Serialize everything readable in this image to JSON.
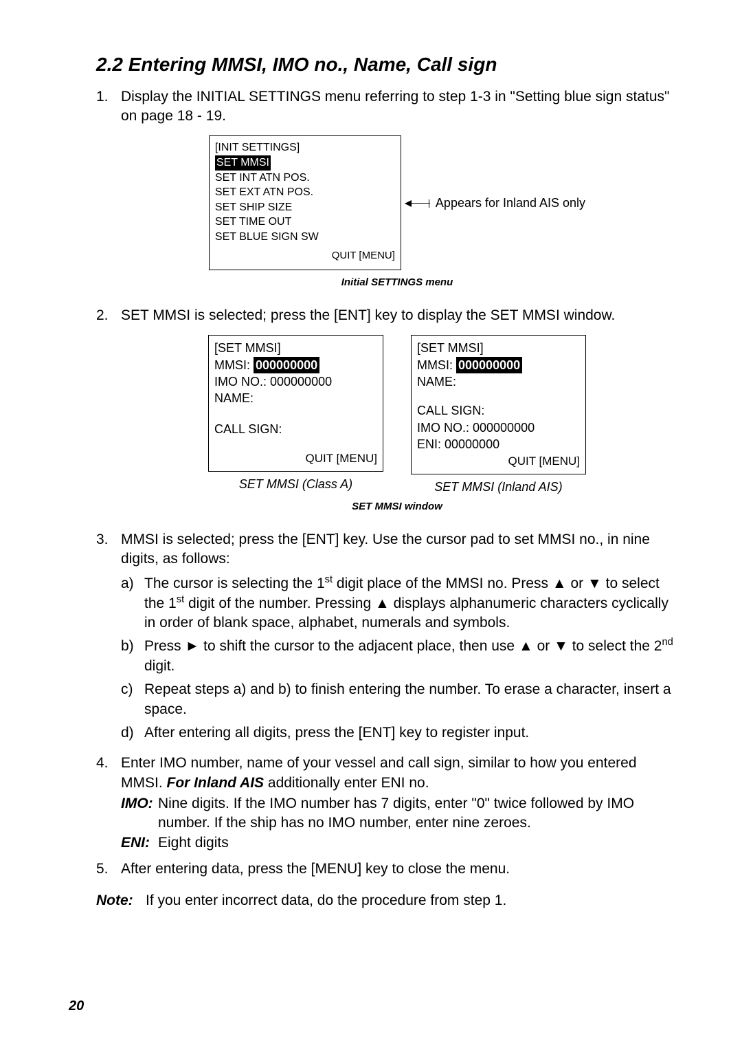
{
  "heading": "2.2 Entering MMSI, IMO no., Name, Call sign",
  "steps": {
    "s1": "Display the INITIAL SETTINGS menu referring to step 1-3 in \"Setting blue sign status\" on page 18 - 19.",
    "s2": "SET MMSI is selected; press the [ENT] key to display the SET MMSI window.",
    "s3_lead": "MMSI is selected; press the [ENT] key. Use the cursor pad to set MMSI no., in nine digits, as follows:",
    "s3a": "The cursor is selecting the 1st digit place of the MMSI no. Press ▲ or ▼ to select the 1st digit of the number. Pressing ▲ displays alphanumeric characters cyclically in order of blank space, alphabet, numerals and symbols.",
    "s3b": "Press ► to shift the cursor to the adjacent place, then use ▲ or ▼ to select the 2nd digit.",
    "s3c": "Repeat steps a) and b) to finish entering the number. To erase a character, insert a space.",
    "s3d": "After entering all digits, press the [ENT] key to register input.",
    "s4_a": "Enter IMO number, name of your vessel and call sign, similar to how you entered MMSI. ",
    "s4_b_bold": "For Inland AIS ",
    "s4_c": "additionally enter ENI no.",
    "s4_imo_label": "IMO:",
    "s4_imo": "Nine digits. If the IMO number has 7 digits, enter \"0\" twice followed by IMO number. If the ship has no IMO number, enter nine zeroes.",
    "s4_eni_label": "ENI:",
    "s4_eni": "Eight digits",
    "s5": "After entering data, press the [MENU] key to close the menu.",
    "note_label": "Note:",
    "note": "If you enter incorrect data, do the procedure from step 1."
  },
  "settings_menu": {
    "title": "[INIT SETTINGS]",
    "items": [
      "SET MMSI",
      "SET INT ATN POS.",
      "SET EXT ATN POS.",
      "SET SHIP SIZE",
      "SET TIME OUT",
      "SET BLUE SIGN SW"
    ],
    "quit": "QUIT [MENU]",
    "arrow_note": "Appears for Inland AIS only",
    "caption": "Initial SETTINGS menu"
  },
  "mmsi_windows": {
    "set_title": "[SET MMSI]",
    "mmsi_label": "MMSI:",
    "mmsi_val": "000000000",
    "imo_label": "IMO NO.: 000000000",
    "name_label": "NAME:",
    "call_label": "CALL SIGN:",
    "eni_label": "ENI:  00000000",
    "quit": "QUIT [MENU]",
    "cap_a": "SET MMSI (Class A)",
    "cap_b": "SET MMSI (Inland AIS)",
    "caption": "SET MMSI window"
  },
  "page_num": "20"
}
